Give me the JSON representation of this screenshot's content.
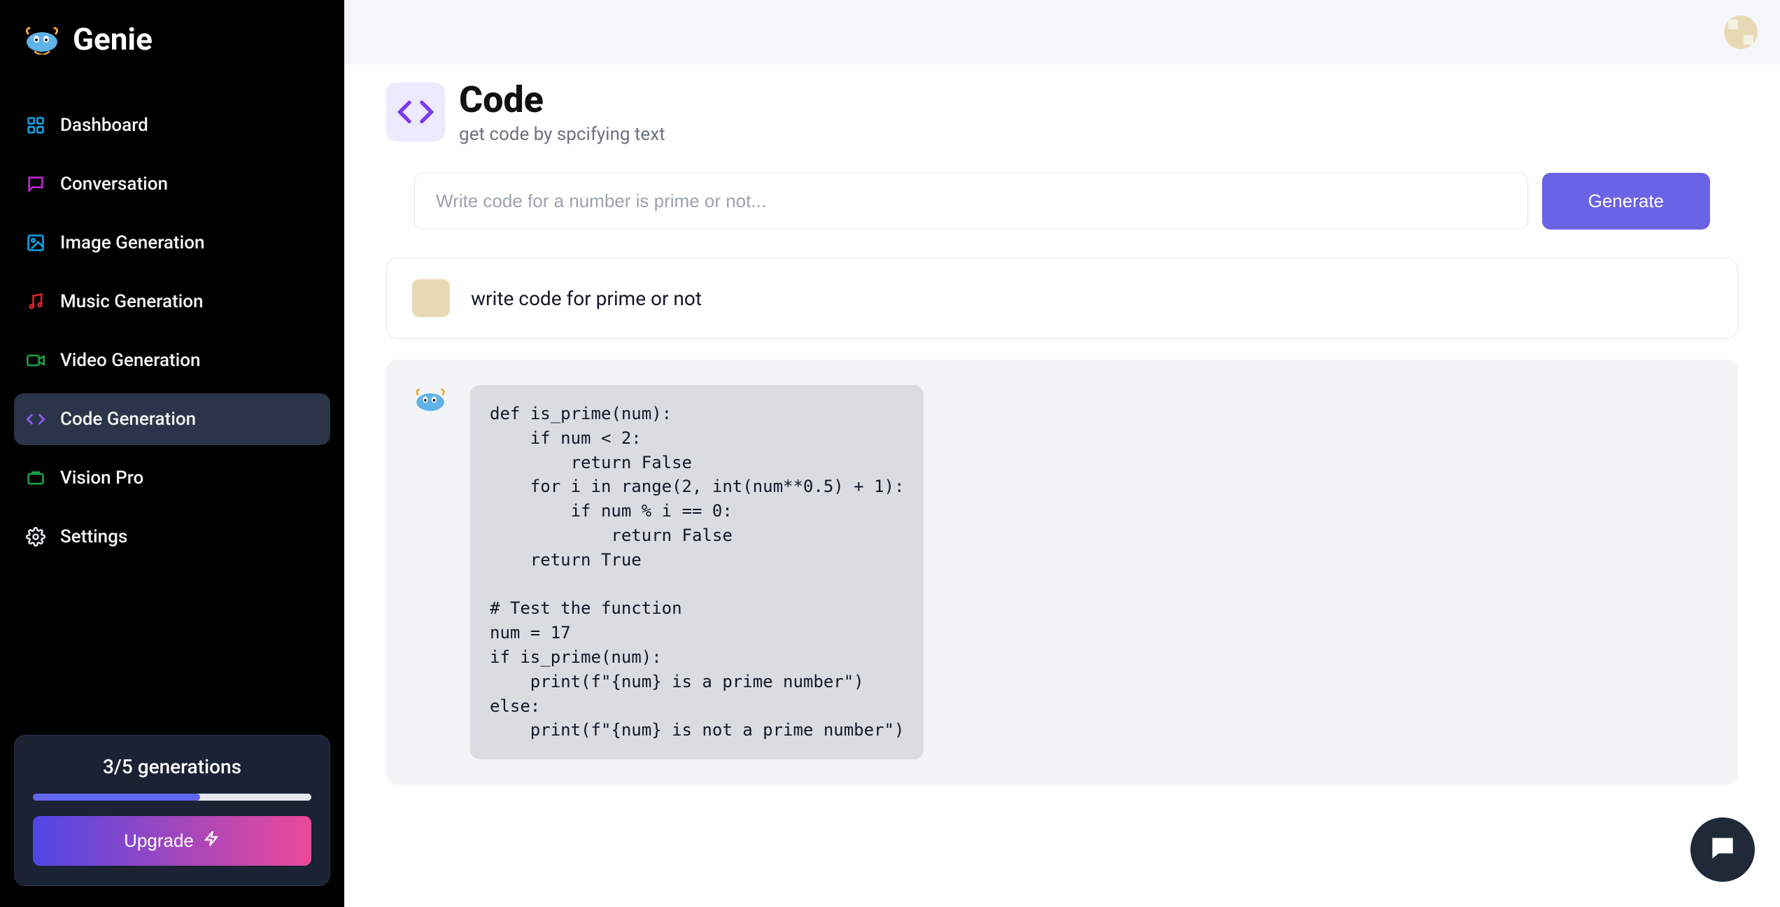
{
  "brand": {
    "name": "Genie"
  },
  "nav": {
    "items": [
      {
        "label": "Dashboard"
      },
      {
        "label": "Conversation"
      },
      {
        "label": "Image Generation"
      },
      {
        "label": "Music Generation"
      },
      {
        "label": "Video Generation"
      },
      {
        "label": "Code Generation"
      },
      {
        "label": "Vision Pro"
      },
      {
        "label": "Settings"
      }
    ]
  },
  "usage": {
    "text": "3/5 generations",
    "percent": 60,
    "upgrade_label": "Upgrade"
  },
  "page": {
    "title": "Code",
    "subtitle": "get code by spcifying text"
  },
  "input": {
    "placeholder": "Write code for a number is prime or not...",
    "button": "Generate"
  },
  "conversation": {
    "user_message": "write code for prime or not",
    "bot_code": "def is_prime(num):\n    if num < 2:\n        return False\n    for i in range(2, int(num**0.5) + 1):\n        if num % i == 0:\n            return False\n    return True\n\n# Test the function\nnum = 17\nif is_prime(num):\n    print(f\"{num} is a prime number\")\nelse:\n    print(f\"{num} is not a prime number\")"
  },
  "colors": {
    "nav_icon": {
      "dashboard": "#0ea5e9",
      "conversation": "#8b5cf6",
      "image": "#ec4899",
      "music": "#ef4444",
      "video": "#f59e0b",
      "code": "#22c55e",
      "vision": "#6366f1",
      "settings": "#9ca3af"
    }
  }
}
